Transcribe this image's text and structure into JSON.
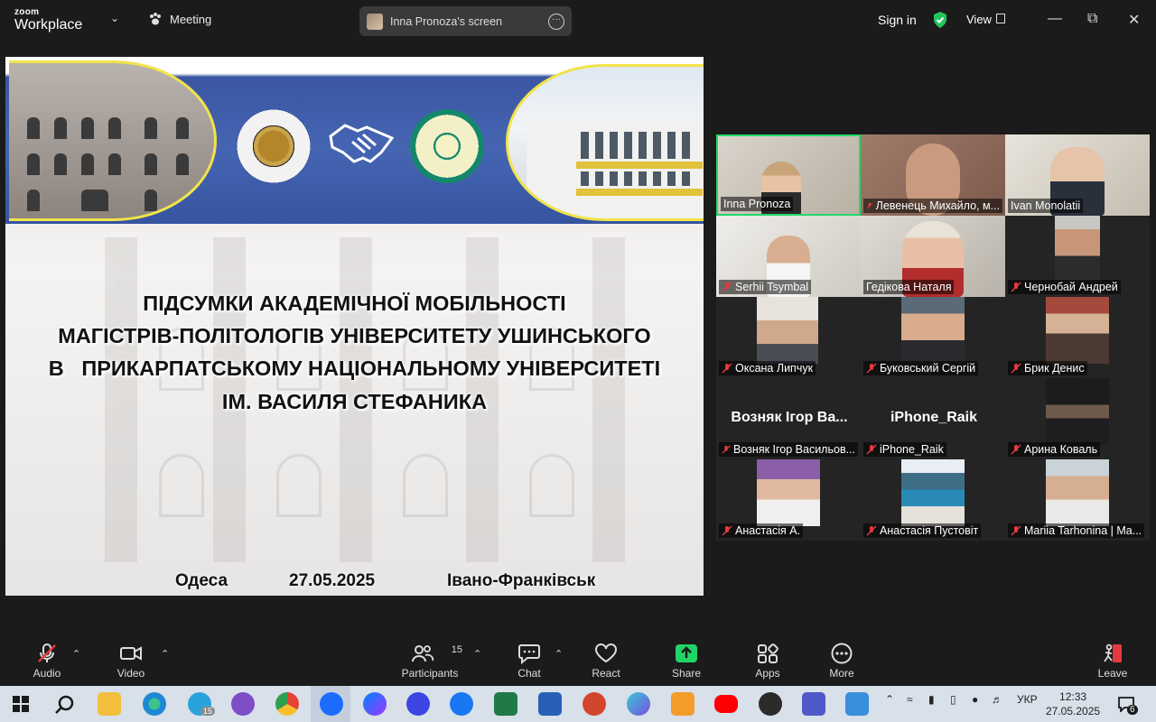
{
  "topbar": {
    "logo_line1": "zoom",
    "logo_line2": "Workplace",
    "meeting_label": "Meeting",
    "screen_share_label": "Inna Pronoza's screen",
    "sign_in": "Sign in",
    "view_label": "View"
  },
  "slide": {
    "title_lines": [
      "ПІДСУМКИ АКАДЕМІЧНОЇ МОБІЛЬНОСТІ",
      "МАГІСТРІВ-ПОЛІТОЛОГІВ УНІВЕРСИТЕТУ УШИНСЬКОГО",
      "В   ПРИКАРПАТСЬКОМУ НАЦІОНАЛЬНОМУ УНІВЕРСИТЕТІ",
      "ІМ. ВАСИЛЯ СТЕФАНИКА"
    ],
    "city_left": "Одеса",
    "date": "27.05.2025",
    "city_right": "Івано-Франківськ"
  },
  "participants": [
    {
      "name": "Inna Pronoza",
      "muted": false,
      "active": true
    },
    {
      "name": "Левенець Михайло, м...",
      "muted": true
    },
    {
      "name": "Ivan Monolatii",
      "muted": false
    },
    {
      "name": "Serhii Tsymbal",
      "muted": true
    },
    {
      "name": "Гедікова Наталя",
      "muted": false
    },
    {
      "name": "Чернобай Андрей",
      "muted": true
    },
    {
      "name": "Оксана Липчук",
      "muted": true
    },
    {
      "name": "Буковський Сергій",
      "muted": true
    },
    {
      "name": "Брик Денис",
      "muted": true
    },
    {
      "name": "Возняк Ігор Васильов...",
      "muted": true,
      "video_off_name": "Возняк Ігор Ва..."
    },
    {
      "name": "iPhone_Raik",
      "muted": true,
      "video_off_name": "iPhone_Raik"
    },
    {
      "name": "Арина Коваль",
      "muted": true
    },
    {
      "name": "Анастасія А.",
      "muted": true
    },
    {
      "name": "Анастасія Пустовіт",
      "muted": true
    },
    {
      "name": "Mariia Tarhonina | Ma...",
      "muted": true
    }
  ],
  "toolbar": {
    "audio": "Audio",
    "video": "Video",
    "participants": "Participants",
    "participants_count": "15",
    "chat": "Chat",
    "react": "React",
    "share": "Share",
    "apps": "Apps",
    "more": "More",
    "leave": "Leave"
  },
  "taskbar": {
    "telegram_badge": "15",
    "language": "УКР",
    "time": "12:33",
    "date": "27.05.2025",
    "notifications": "6"
  },
  "colors": {
    "accent_green": "#23d96b",
    "share_green": "#1fd566",
    "leave_red": "#e5393f",
    "muted_red": "#e5393f"
  }
}
